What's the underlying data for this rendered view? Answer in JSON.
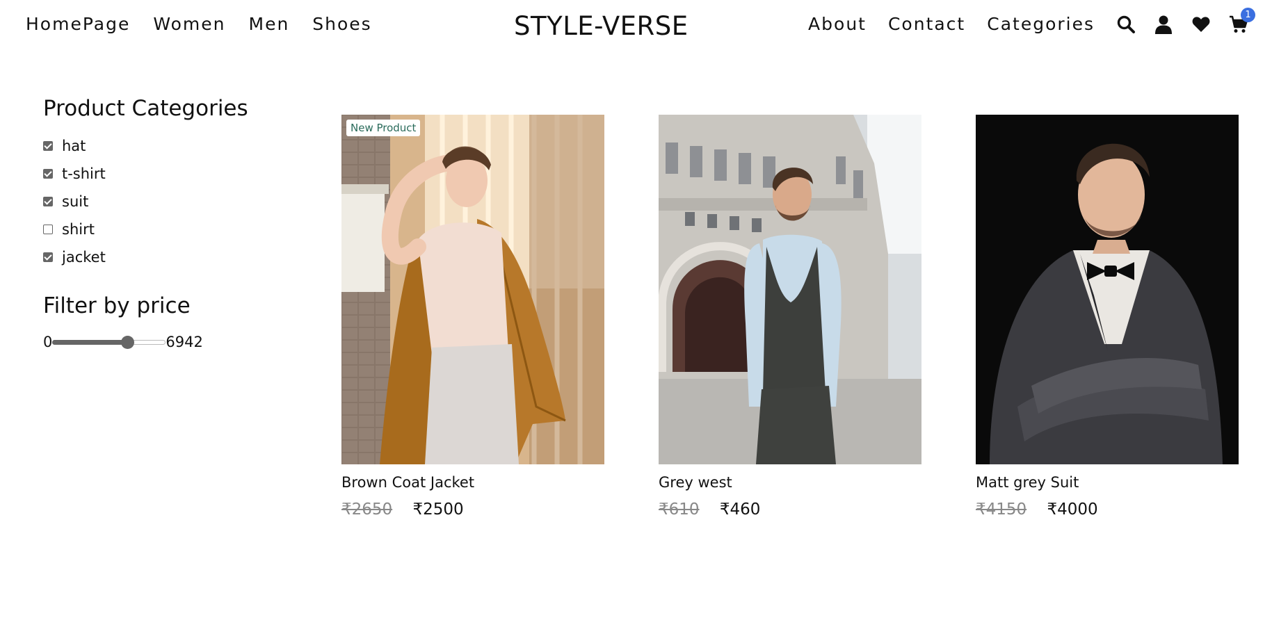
{
  "nav": {
    "left_links": [
      "HomePage",
      "Women",
      "Men",
      "Shoes"
    ],
    "brand": "STYLE-VERSE",
    "right_links": [
      "About",
      "Contact",
      "Categories"
    ],
    "icons": [
      "search-icon",
      "user-icon",
      "heart-icon",
      "cart-icon"
    ],
    "cart_count": "1",
    "badge_color": "#3b6fe0"
  },
  "sidebar": {
    "categories_heading": "Product Categories",
    "categories": [
      {
        "label": "hat",
        "checked": true
      },
      {
        "label": "t-shirt",
        "checked": true
      },
      {
        "label": "suit",
        "checked": true
      },
      {
        "label": "shirt",
        "checked": false
      },
      {
        "label": "jacket",
        "checked": true
      }
    ],
    "price_heading": "Filter by price",
    "price_min": "0",
    "price_max": "6942",
    "slider_value_fraction": 0.66
  },
  "products": [
    {
      "badge": "New Product",
      "name": "Brown Coat Jacket",
      "old_price": "₹2650",
      "price": "₹2500"
    },
    {
      "badge": "",
      "name": "Grey west",
      "old_price": "₹610",
      "price": "₹460"
    },
    {
      "badge": "",
      "name": "Matt grey Suit",
      "old_price": "₹4150",
      "price": "₹4000"
    }
  ]
}
